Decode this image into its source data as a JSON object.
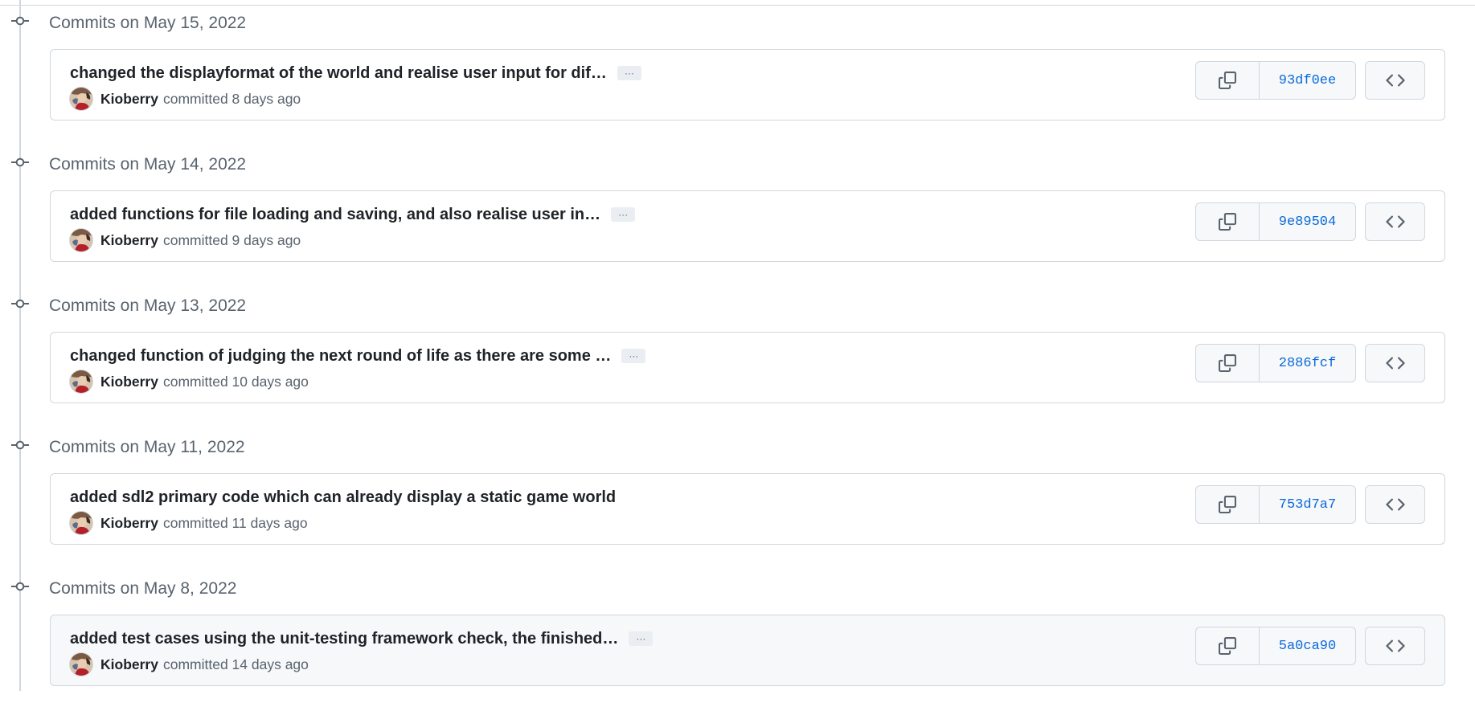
{
  "groups": [
    {
      "title": "Commits on May 15, 2022",
      "commit": {
        "message": "changed the displayformat of the world and realise user input for dif…",
        "has_more": true,
        "more_label": "···",
        "author": "Kioberry",
        "committed": "committed 8 days ago",
        "sha": "93df0ee",
        "hovered": false
      }
    },
    {
      "title": "Commits on May 14, 2022",
      "commit": {
        "message": "added functions for file loading and saving, and also realise user in…",
        "has_more": true,
        "more_label": "···",
        "author": "Kioberry",
        "committed": "committed 9 days ago",
        "sha": "9e89504",
        "hovered": false
      }
    },
    {
      "title": "Commits on May 13, 2022",
      "commit": {
        "message": "changed function of judging the next round of life as there are some …",
        "has_more": true,
        "more_label": "···",
        "author": "Kioberry",
        "committed": "committed 10 days ago",
        "sha": "2886fcf",
        "hovered": false
      }
    },
    {
      "title": "Commits on May 11, 2022",
      "commit": {
        "message": "added sdl2 primary code which can already display a static game world",
        "has_more": false,
        "more_label": "",
        "author": "Kioberry",
        "committed": "committed 11 days ago",
        "sha": "753d7a7",
        "hovered": false
      }
    },
    {
      "title": "Commits on May 8, 2022",
      "commit": {
        "message": "added test cases using the unit-testing framework check, the finished…",
        "has_more": true,
        "more_label": "···",
        "author": "Kioberry",
        "committed": "committed 14 days ago",
        "sha": "5a0ca90",
        "hovered": true
      }
    }
  ],
  "icons": {
    "commit_node": "git-commit-icon",
    "copy": "copy-icon",
    "browse": "code-icon"
  },
  "colors": {
    "sha_link": "#0969da",
    "border": "#d0d7de",
    "muted_text": "#59636e",
    "hover_bg": "#f6f8fa"
  }
}
